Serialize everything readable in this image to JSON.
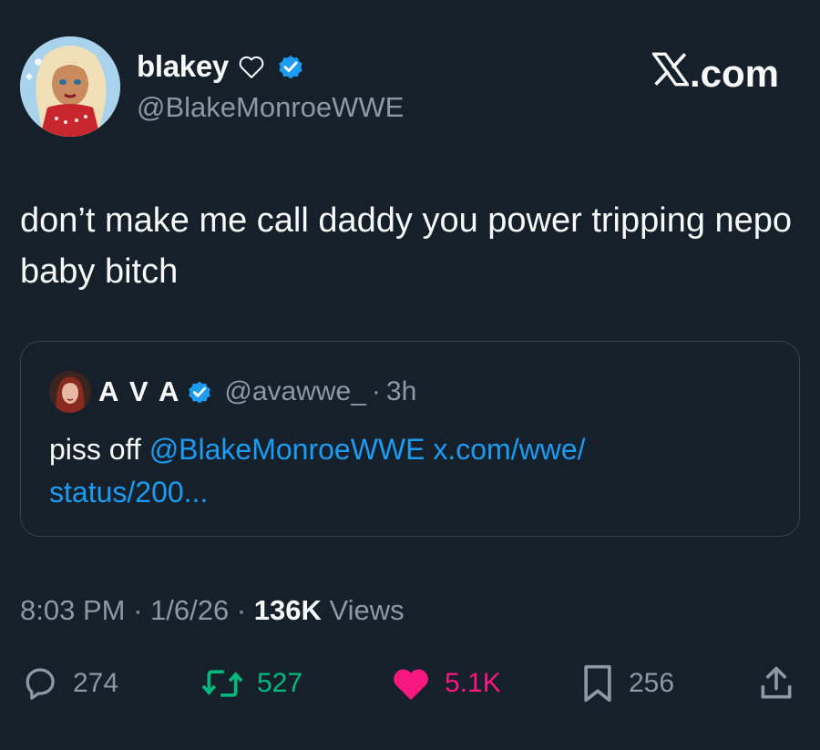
{
  "author": {
    "display_name": "blakey",
    "handle": "@BlakeMonroeWWE",
    "verified": true
  },
  "brand": {
    "label": ".com",
    "logo": "x-logo"
  },
  "tweet": {
    "text": "don’t make me call daddy you power tripping nepo baby bitch"
  },
  "quoted": {
    "display_name": "A V A",
    "handle": "@avawwe_",
    "separator": "·",
    "time": "3h",
    "text_prefix": "piss off ",
    "mention": "@BlakeMonroeWWE",
    "link_line1": " x.com/wwe/",
    "link_line2": "status/200..."
  },
  "meta": {
    "time": "8:03 PM",
    "dot1": " · ",
    "date": "1/6/26",
    "dot2": " · ",
    "views_count": "136K",
    "views_label": " Views"
  },
  "actions": {
    "replies": "274",
    "reposts": "527",
    "likes": "5.1K",
    "bookmarks": "256"
  },
  "colors": {
    "background": "#15202b",
    "muted": "#8b98a5",
    "link": "#1d9bf0",
    "repost": "#00ba7c",
    "like": "#f91880",
    "border": "#38444d"
  }
}
